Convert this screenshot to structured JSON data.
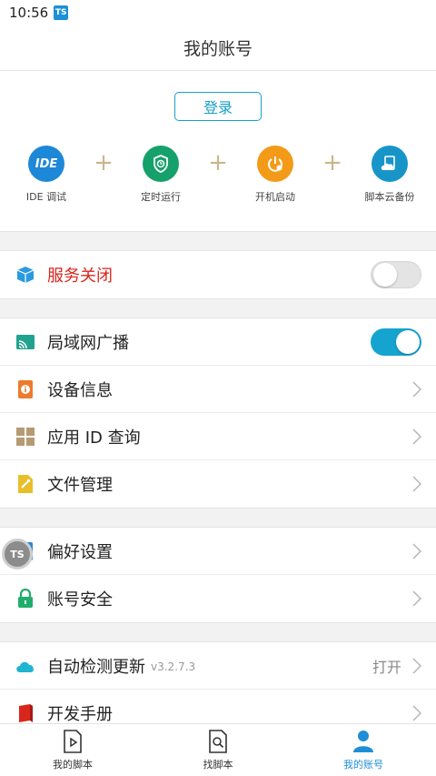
{
  "status_bar": {
    "time": "10:56",
    "badge": "TS"
  },
  "header": {
    "title": "我的账号"
  },
  "login": {
    "label": "登录"
  },
  "features": [
    {
      "icon": "ide-icon",
      "glyph": "IDE",
      "label": "IDE 调试",
      "color": "#1e88d8"
    },
    {
      "icon": "clock-shield-icon",
      "label": "定时运行",
      "color": "#16a06a"
    },
    {
      "icon": "power-icon",
      "label": "开机启动",
      "color": "#f39b18"
    },
    {
      "icon": "cloud-backup-icon",
      "label": "脚本云备份",
      "color": "#1795c9"
    }
  ],
  "sections": {
    "service": {
      "label": "服务关闭",
      "enabled": false,
      "icon": "cube-icon",
      "label_color": "#d9261c"
    },
    "group1": [
      {
        "label": "局域网广播",
        "type": "toggle",
        "enabled": true,
        "icon": "cast-icon"
      },
      {
        "label": "设备信息",
        "type": "link",
        "icon": "device-info-icon"
      },
      {
        "label": "应用 ID 查询",
        "type": "link",
        "icon": "grid-icon"
      },
      {
        "label": "文件管理",
        "type": "link",
        "icon": "file-icon"
      }
    ],
    "group2": [
      {
        "label": "偏好设置",
        "type": "link",
        "icon": "settings-icon"
      },
      {
        "label": "账号安全",
        "type": "link",
        "icon": "lock-icon"
      }
    ],
    "group3": [
      {
        "label": "自动检测更新",
        "version": "v3.2.7.3",
        "value": "打开",
        "type": "link",
        "icon": "cloud-icon"
      },
      {
        "label": "开发手册",
        "type": "link",
        "icon": "book-icon"
      }
    ]
  },
  "floating_button": {
    "label": "TS"
  },
  "bottom_nav": [
    {
      "label": "我的脚本",
      "icon": "script-play-icon",
      "active": false
    },
    {
      "label": "找脚本",
      "icon": "search-doc-icon",
      "active": false
    },
    {
      "label": "我的账号",
      "icon": "user-icon",
      "active": true
    }
  ],
  "colors": {
    "accent": "#14a4cf",
    "danger": "#d9261c"
  }
}
